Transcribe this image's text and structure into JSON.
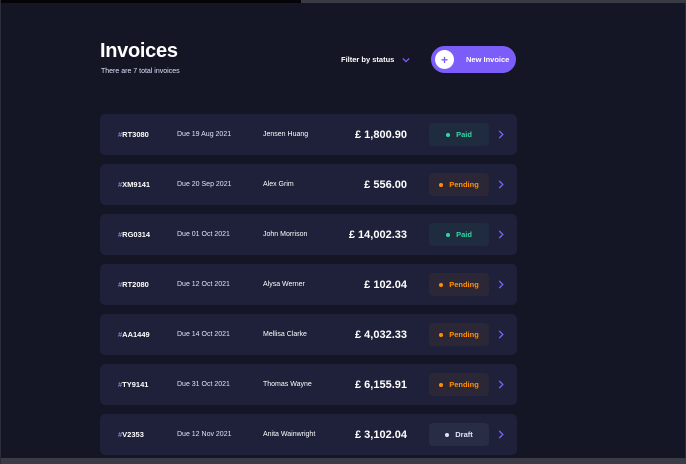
{
  "header": {
    "title": "Invoices",
    "subtitle": "There are 7 total invoices",
    "filter_label": "Filter by status",
    "new_button_label": "New Invoice"
  },
  "colors": {
    "background": "#141625",
    "card": "#1e2139",
    "accent": "#7c5dfa",
    "paid": "#33d69f",
    "pending": "#ff8f00",
    "draft": "#dfe3fa"
  },
  "icons": {
    "filter": "chevron-down-icon",
    "new": "plus-icon",
    "row": "chevron-right-icon"
  },
  "invoices": [
    {
      "hash": "#",
      "id": "RT3080",
      "due": "Due  19 Aug 2021",
      "client": "Jensen Huang",
      "amount": "£ 1,800.90",
      "status": "Paid",
      "status_key": "paid"
    },
    {
      "hash": "#",
      "id": "XM9141",
      "due": "Due  20 Sep 2021",
      "client": "Alex Grim",
      "amount": "£ 556.00",
      "status": "Pending",
      "status_key": "pending"
    },
    {
      "hash": "#",
      "id": "RG0314",
      "due": "Due  01 Oct 2021",
      "client": "John Morrison",
      "amount": "£ 14,002.33",
      "status": "Paid",
      "status_key": "paid"
    },
    {
      "hash": "#",
      "id": "RT2080",
      "due": "Due  12 Oct 2021",
      "client": "Alysa Werner",
      "amount": "£ 102.04",
      "status": "Pending",
      "status_key": "pending"
    },
    {
      "hash": "#",
      "id": "AA1449",
      "due": "Due  14 Oct 2021",
      "client": "Mellisa Clarke",
      "amount": "£ 4,032.33",
      "status": "Pending",
      "status_key": "pending"
    },
    {
      "hash": "#",
      "id": "TY9141",
      "due": "Due  31 Oct 2021",
      "client": "Thomas Wayne",
      "amount": "£ 6,155.91",
      "status": "Pending",
      "status_key": "pending"
    },
    {
      "hash": "#",
      "id": " V2353",
      "due": "Due  12 Nov 2021",
      "client": "Anita Wainwright",
      "amount": "£ 3,102.04",
      "status": "Draft",
      "status_key": "draft"
    }
  ]
}
